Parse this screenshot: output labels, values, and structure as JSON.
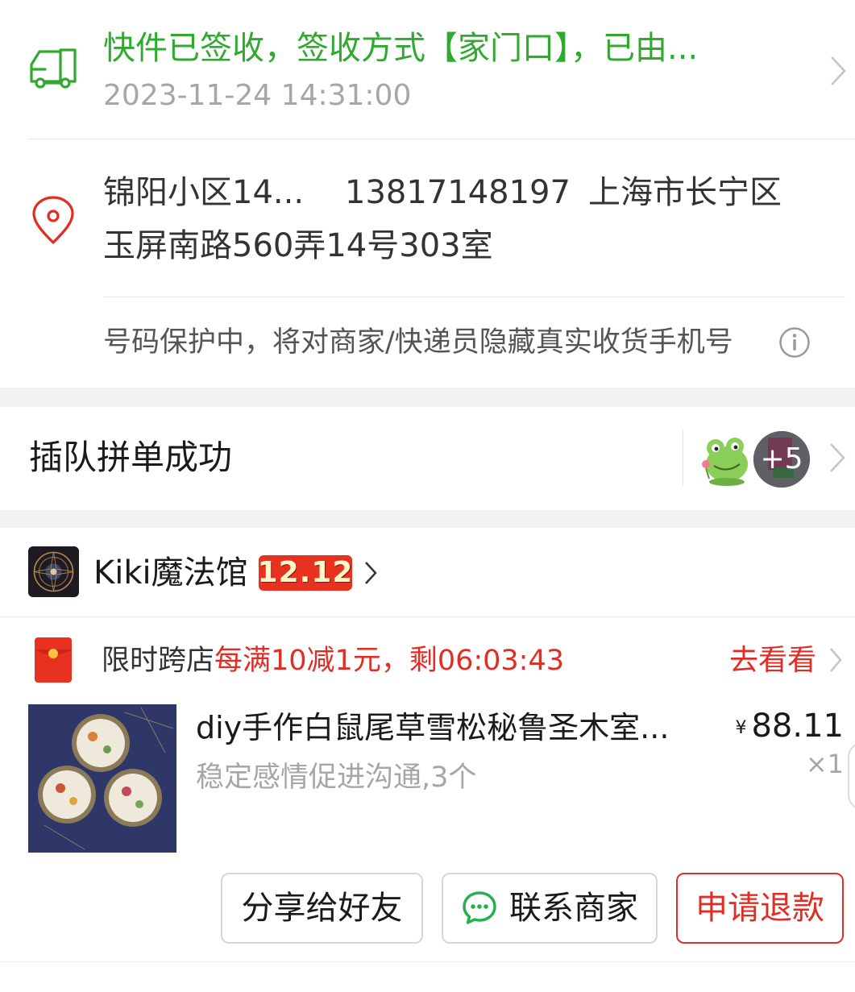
{
  "colors": {
    "green": "#2faa2f",
    "red": "#e02e24",
    "gray_text": "#a6a6a6"
  },
  "logistics": {
    "icon": "truck-icon",
    "status": "快件已签收，签收方式【家门口】，已由...",
    "time": "2023-11-24 14:31:00"
  },
  "address": {
    "icon": "location-pin-icon",
    "name": "锦阳小区14...",
    "phone": "13817148197",
    "region": "上海市长宁区",
    "detail": "玉屏南路560弄14号303室",
    "privacy_note": "号码保护中，将对商家/快递员隐藏真实收货手机号",
    "info_icon": "info-icon"
  },
  "group": {
    "title": "插队拼单成功",
    "more_count": "+5"
  },
  "shop": {
    "name": "Kiki魔法馆",
    "badge": "12.12"
  },
  "promo": {
    "icon": "red-envelope-icon",
    "label": "限时跨店",
    "offer": "每满10减1元，剩06:03:43",
    "link": "去看看"
  },
  "product": {
    "title": "diy手作白鼠尾草雪松秘鲁圣木室...",
    "spec": "稳定感情促进沟通,3个",
    "currency": "¥",
    "price": "88.11",
    "quantity": "×1"
  },
  "actions": {
    "share": "分享给好友",
    "contact": "联系商家",
    "refund": "申请退款"
  }
}
